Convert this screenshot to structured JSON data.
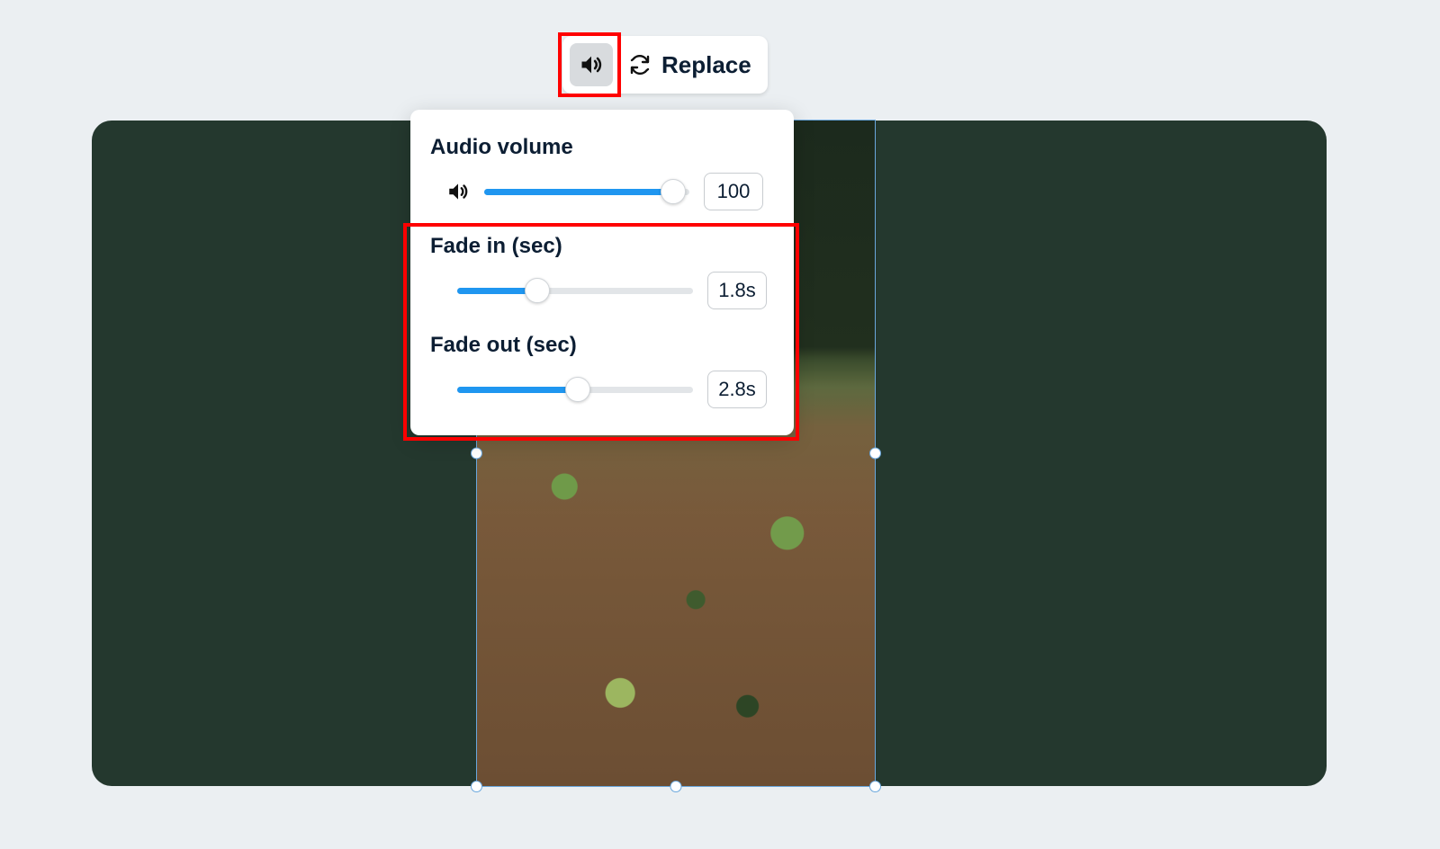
{
  "toolbar": {
    "audio_icon": "volume-icon",
    "replace_icon": "refresh-icon",
    "replace_label": "Replace"
  },
  "panel": {
    "volume": {
      "title": "Audio volume",
      "icon": "volume-icon",
      "slider_pct": 92,
      "slider_width": 228,
      "value": "100"
    },
    "fade_in": {
      "title": "Fade in (sec)",
      "slider_pct": 34,
      "slider_width": 262,
      "value": "1.8s"
    },
    "fade_out": {
      "title": "Fade out (sec)",
      "slider_pct": 51,
      "slider_width": 262,
      "value": "2.8s"
    }
  }
}
